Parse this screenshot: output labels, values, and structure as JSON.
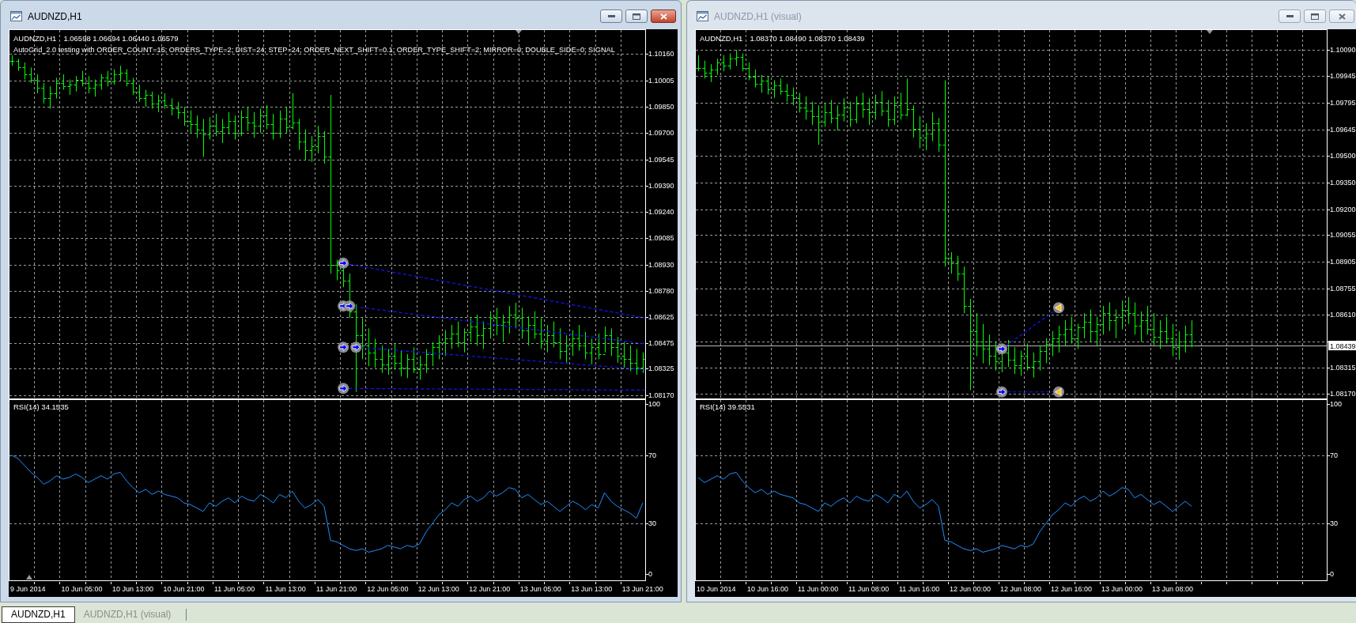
{
  "windows": [
    {
      "title": "AUDNZD,H1",
      "active": true,
      "chart": {
        "symbol": "AUDNZD,H1",
        "ohlc": "1.06598 1.06694 1.06440 1.06579",
        "comment": "AutoGrid_2.0 testing with ORDER_COUNT=15; ORDERS_TYPE=2; DIST=24; STEP=24; ORDER_NEXT_SHIFT=0.1; ORDER_TYPE_SHIFT=2; MIRROR=0; DOUBLE_SIDE=0; SIGNAL",
        "price_axis": [
          "1.10160",
          "1.10005",
          "1.09850",
          "1.09700",
          "1.09545",
          "1.09390",
          "1.09240",
          "1.09085",
          "1.08930",
          "1.08780",
          "1.08625",
          "1.08475",
          "1.08325",
          "1.08170"
        ],
        "indicator": {
          "label": "RSI(14) 34.1535",
          "chart_data": {
            "type": "line",
            "grid": true,
            "series": [
              {
                "values": [
                  70,
                  68,
                  64,
                  60,
                  57,
                  53,
                  55,
                  58,
                  56,
                  57,
                  59,
                  57,
                  54,
                  56,
                  58,
                  56,
                  59,
                  60,
                  55,
                  51,
                  48,
                  50,
                  47,
                  49,
                  47,
                  46,
                  45,
                  42,
                  41,
                  39,
                  37,
                  42,
                  40,
                  43,
                  45,
                  42,
                  46,
                  44,
                  43,
                  47,
                  45,
                  42,
                  47,
                  45,
                  49,
                  43,
                  39,
                  41,
                  44,
                  40,
                  20,
                  19,
                  17,
                  15,
                  14,
                  15,
                  13,
                  14,
                  15,
                  17,
                  16,
                  15,
                  17,
                  16,
                  18,
                  25,
                  30,
                  35,
                  38,
                  42,
                  40,
                  44,
                  46,
                  43,
                  45,
                  49,
                  46,
                  48,
                  51,
                  50,
                  45,
                  47,
                  44,
                  41,
                  43,
                  40,
                  37,
                  40,
                  43,
                  41,
                  38,
                  41,
                  39,
                  48,
                  43,
                  40,
                  38,
                  36,
                  33,
                  42
                ]
              }
            ],
            "ylim": [
              -4,
              103
            ],
            "yticks": [
              {
                "value": 100,
                "label": "100"
              },
              {
                "value": 70,
                "label": "70"
              },
              {
                "value": 30,
                "label": "30"
              },
              {
                "value": 0,
                "label": "0"
              }
            ]
          },
          "time_axis": [
            "9 Jun 2014",
            "10 Jun 05:00",
            "10 Jun 13:00",
            "10 Jun 21:00",
            "11 Jun 05:00",
            "11 Jun 13:00",
            "11 Jun 21:00",
            "12 Jun 05:00",
            "12 Jun 13:00",
            "12 Jun 21:00",
            "13 Jun 05:00",
            "13 Jun 13:00",
            "13 Jun 21:00"
          ]
        }
      }
    },
    {
      "title": "AUDNZD,H1 (visual)",
      "active": false,
      "chart": {
        "symbol": "AUDNZD,H1",
        "ohlc": "1.08370 1.08490 1.08370 1.08439",
        "price_axis": [
          "1.10090",
          "1.09945",
          "1.09795",
          "1.09645",
          "1.09500",
          "1.09350",
          "1.09200",
          "1.09055",
          "1.08905",
          "1.08755",
          "1.08610",
          "1.08315",
          "1.08170"
        ],
        "current_price": "1.08439",
        "indicator": {
          "label": "RSI(14) 39.5531",
          "chart_data": {
            "type": "line",
            "grid": true,
            "series": [
              {
                "values": [
                  57,
                  54,
                  56,
                  58,
                  56,
                  59,
                  60,
                  55,
                  51,
                  48,
                  50,
                  47,
                  49,
                  47,
                  46,
                  45,
                  42,
                  41,
                  39,
                  37,
                  42,
                  40,
                  43,
                  45,
                  42,
                  46,
                  44,
                  43,
                  47,
                  45,
                  42,
                  47,
                  45,
                  49,
                  43,
                  39,
                  41,
                  44,
                  40,
                  20,
                  19,
                  17,
                  15,
                  14,
                  15,
                  13,
                  14,
                  15,
                  17,
                  16,
                  15,
                  17,
                  16,
                  18,
                  25,
                  30,
                  35,
                  38,
                  42,
                  40,
                  44,
                  46,
                  43,
                  45,
                  49,
                  46,
                  48,
                  51,
                  50,
                  45,
                  47,
                  44,
                  41,
                  43,
                  40,
                  37,
                  40,
                  43,
                  40,
                  null,
                  null,
                  null,
                  null,
                  null,
                  null,
                  null,
                  null,
                  null,
                  null,
                  null,
                  null,
                  null,
                  null,
                  null,
                  null,
                  null,
                  null,
                  null,
                  null,
                  null
                ]
              }
            ],
            "ylim": [
              -4,
              103
            ],
            "yticks": [
              {
                "value": 100,
                "label": "100"
              },
              {
                "value": 70,
                "label": "70"
              },
              {
                "value": 30,
                "label": "30"
              },
              {
                "value": 0,
                "label": "0"
              }
            ]
          },
          "time_axis": [
            "10 Jun 2014",
            "10 Jun 16:00",
            "11 Jun 00:00",
            "11 Jun 08:00",
            "11 Jun 16:00",
            "12 Jun 00:00",
            "12 Jun 08:00",
            "12 Jun 16:00",
            "13 Jun 00:00",
            "13 Jun 08:00"
          ]
        }
      }
    }
  ],
  "tabs": [
    {
      "label": "AUDNZD,H1",
      "selected": true
    },
    {
      "label": "AUDNZD,H1 (visual)",
      "selected": false
    }
  ]
}
